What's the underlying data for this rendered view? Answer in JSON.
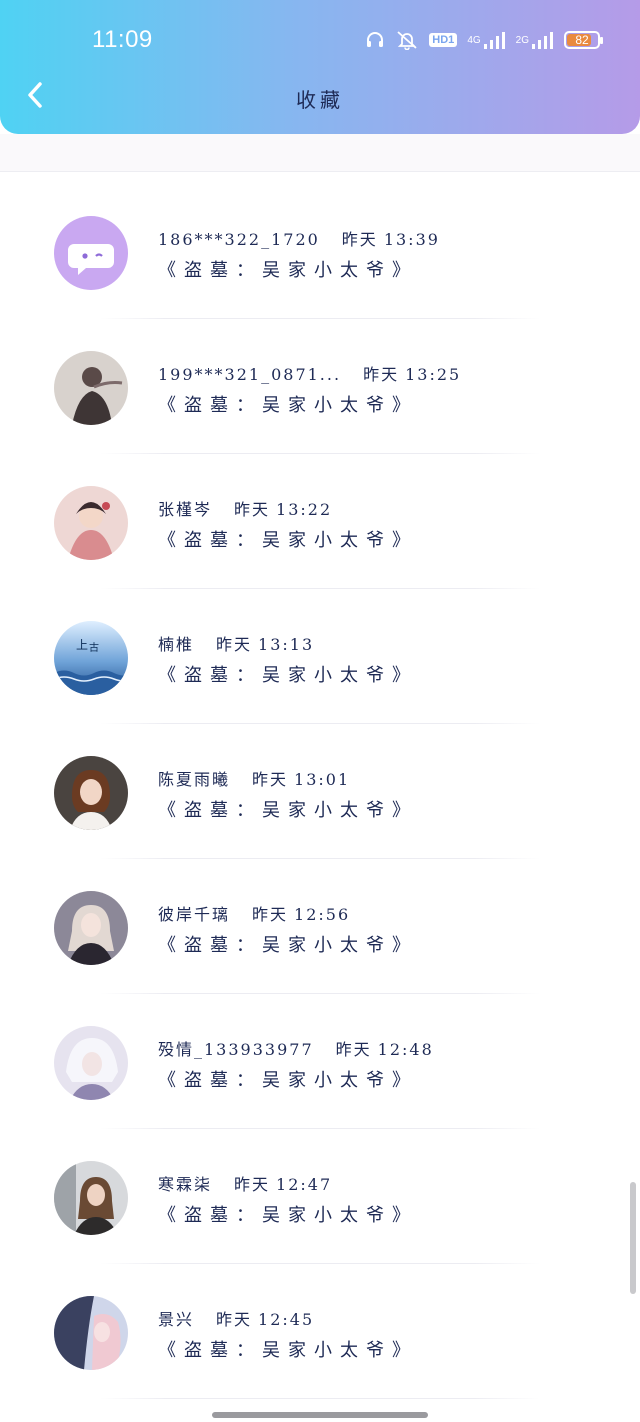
{
  "status_bar": {
    "time": "11:09",
    "hd_label": "HD1",
    "net1_label": "4G",
    "net2_label": "2G",
    "battery_level": "82",
    "battery_fraction": 0.82,
    "icons": [
      "headphones-icon",
      "mute-bell-icon",
      "hd-badge",
      "signal-4g-icon",
      "signal-2g-icon",
      "battery-icon"
    ]
  },
  "header": {
    "back_icon": "chevron-left-icon",
    "title": "收藏"
  },
  "colors": {
    "header_gradient_start": "#4fd2f3",
    "header_gradient_end": "#b59be8",
    "text": "#1e2a55",
    "battery_accent": "#e98a3f"
  },
  "favorites": [
    {
      "user": "186***322_1720",
      "day": "昨天",
      "time": "13:39",
      "message": "《盗墓：吴家小太爷》",
      "avatar": "default-chat-bubble-avatar"
    },
    {
      "user": "199***321_0871...",
      "day": "昨天",
      "time": "13:25",
      "message": "《盗墓：吴家小太爷》",
      "avatar": "ink-painting-figure-avatar"
    },
    {
      "user": "张槿岑",
      "day": "昨天",
      "time": "13:22",
      "message": "《盗墓：吴家小太爷》",
      "avatar": "ancient-style-girl-avatar"
    },
    {
      "user": "楠椎",
      "day": "昨天",
      "time": "13:13",
      "message": "《盗墓：吴家小太爷》",
      "avatar": "ocean-sky-avatar"
    },
    {
      "user": "陈夏雨曦",
      "day": "昨天",
      "time": "13:01",
      "message": "《盗墓：吴家小太爷》",
      "avatar": "portrait-woman-avatar"
    },
    {
      "user": "彼岸千璃",
      "day": "昨天",
      "time": "12:56",
      "message": "《盗墓：吴家小太爷》",
      "avatar": "anime-girl-dark-avatar"
    },
    {
      "user": "殁情_133933977",
      "day": "昨天",
      "time": "12:48",
      "message": "《盗墓：吴家小太爷》",
      "avatar": "white-hair-anime-avatar"
    },
    {
      "user": "寒霖柒",
      "day": "昨天",
      "time": "12:47",
      "message": "《盗墓：吴家小太爷》",
      "avatar": "photo-woman-avatar"
    },
    {
      "user": "景兴",
      "day": "昨天",
      "time": "12:45",
      "message": "《盗墓：吴家小太爷》",
      "avatar": "anime-couple-avatar"
    }
  ]
}
